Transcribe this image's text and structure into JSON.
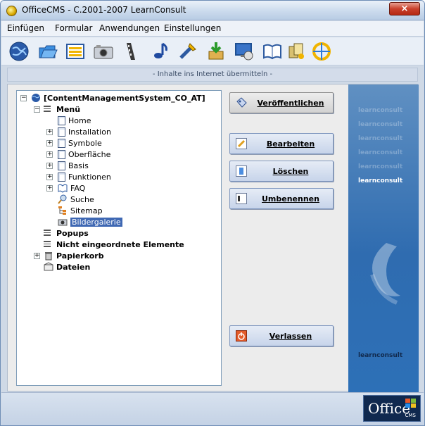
{
  "window": {
    "title": "OfficeCMS - C.2001-2007 LearnConsult",
    "close_glyph": "×"
  },
  "menu": {
    "items": [
      "Einfügen",
      "Formular",
      "Anwendungen",
      "Einstellungen"
    ]
  },
  "toolbar": {
    "icons": [
      "globe-icon",
      "folder-icon",
      "list-icon",
      "camera-icon",
      "film-icon",
      "music-icon",
      "tools-icon",
      "download-icon",
      "screen-icon",
      "book-icon",
      "gallery-icon",
      "compass-icon"
    ]
  },
  "status_top": "- Inhalte ins Internet übermitteln -",
  "tree": {
    "root": "[ContentManagementSystem_CO_AT]",
    "menu": "Menü",
    "menu_children": [
      "Home",
      "Installation",
      "Symbole",
      "Oberfläche",
      "Basis",
      "Funktionen",
      "FAQ",
      "Suche",
      "Sitemap",
      "Bildergalerie"
    ],
    "popups": "Popups",
    "unsorted": "Nicht eingeordnete Elemente",
    "trash": "Papierkorb",
    "files": "Dateien",
    "selected": "Bildergalerie"
  },
  "buttons": {
    "publish": "Veröffentlichen",
    "edit": "Bearbeiten",
    "delete": "Löschen",
    "rename": "Umbenennen",
    "exit": "Verlassen"
  },
  "branding": {
    "sidebar_logo": "learnconsult",
    "bottom_logo": "learnconsult",
    "office": "Office",
    "cms": "CMS"
  },
  "colors": {
    "accent": "#2f6cb0",
    "selection": "#3f68b3"
  }
}
